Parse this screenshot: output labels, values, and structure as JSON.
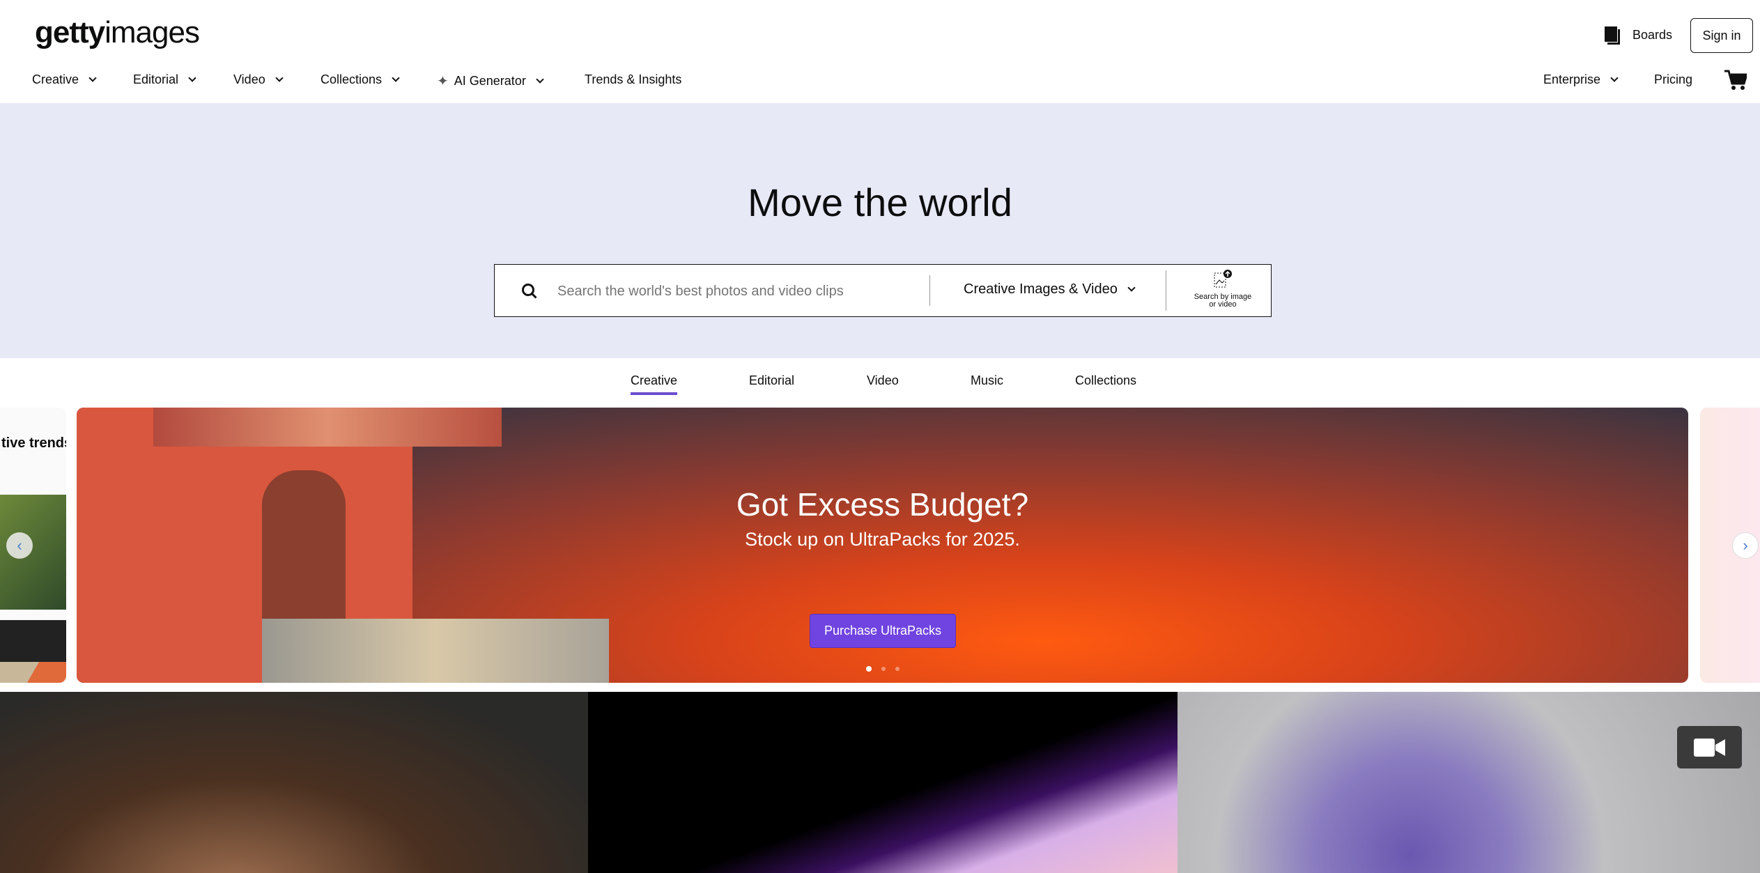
{
  "header": {
    "logo": {
      "bold": "getty",
      "light": "images"
    },
    "boards_label": "Boards",
    "signin_label": "Sign in",
    "nav_left": [
      {
        "label": "Creative",
        "dropdown": true
      },
      {
        "label": "Editorial",
        "dropdown": true
      },
      {
        "label": "Video",
        "dropdown": true
      },
      {
        "label": "Collections",
        "dropdown": true
      },
      {
        "label": "AI Generator",
        "dropdown": true,
        "icon": "sparkle-icon"
      },
      {
        "label": "Trends & Insights",
        "dropdown": false
      }
    ],
    "nav_right": [
      {
        "label": "Enterprise",
        "dropdown": true
      },
      {
        "label": "Pricing",
        "dropdown": false
      }
    ]
  },
  "hero": {
    "title": "Move the world",
    "search": {
      "placeholder": "Search the world's best photos and video clips",
      "value": "",
      "category": "Creative Images & Video",
      "image_search_label_1": "Search by image",
      "image_search_label_2": "or video"
    },
    "background": "#e8e9f7"
  },
  "tabs": [
    {
      "label": "Creative",
      "active": true
    },
    {
      "label": "Editorial",
      "active": false
    },
    {
      "label": "Video",
      "active": false
    },
    {
      "label": "Music",
      "active": false
    },
    {
      "label": "Collections",
      "active": false
    }
  ],
  "banner": {
    "headline": "Got Excess Budget?",
    "subhead": "Stock up on UltraPacks for 2025.",
    "cta": "Purchase UltraPacks",
    "cta_color": "#7044e0",
    "slide_count": 3,
    "active_slide": 1,
    "peek_left_title": "tive trends"
  },
  "accent": "#6b4fcf"
}
